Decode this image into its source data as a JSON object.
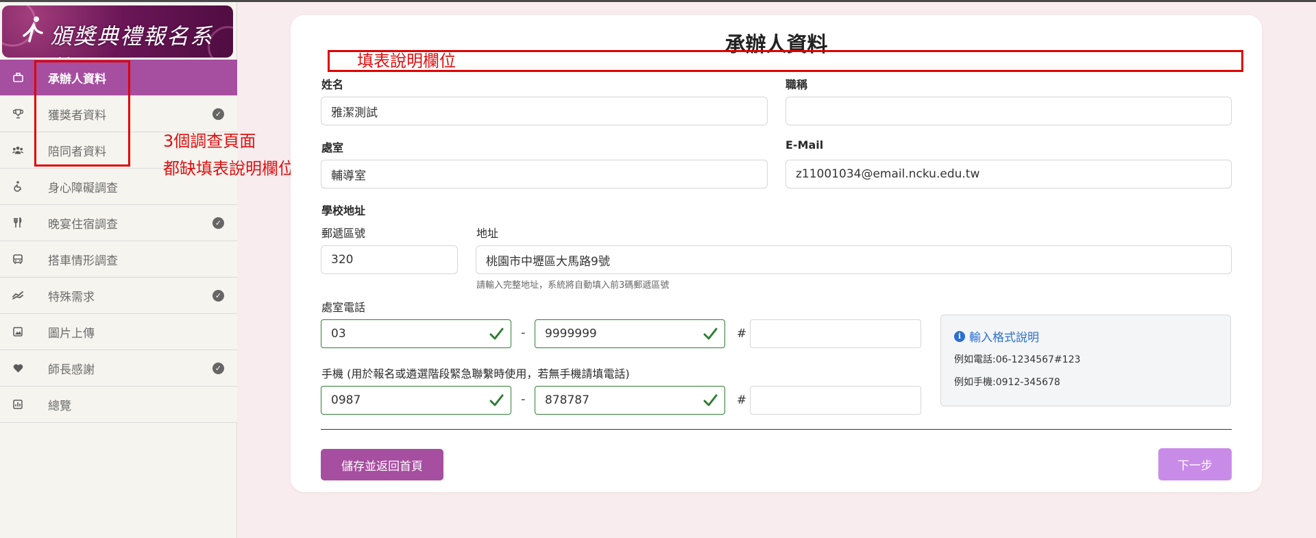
{
  "logo": {
    "text": "頒獎典禮報名系統",
    "glyph": "ﻝ"
  },
  "sidebar": {
    "items": [
      {
        "label": "承辦人資料",
        "icon": "briefcase-icon",
        "active": true,
        "checked": false
      },
      {
        "label": "獲獎者資料",
        "icon": "trophy-icon",
        "active": false,
        "checked": true
      },
      {
        "label": "陪同者資料",
        "icon": "users-icon",
        "active": false,
        "checked": false
      },
      {
        "label": "身心障礙調查",
        "icon": "accessibility-icon",
        "active": false,
        "checked": false
      },
      {
        "label": "晚宴住宿調查",
        "icon": "utensils-icon",
        "active": false,
        "checked": true
      },
      {
        "label": "搭車情形調查",
        "icon": "bus-icon",
        "active": false,
        "checked": false
      },
      {
        "label": "特殊需求",
        "icon": "hands-icon",
        "active": false,
        "checked": true
      },
      {
        "label": "圖片上傳",
        "icon": "image-icon",
        "active": false,
        "checked": false
      },
      {
        "label": "師長感謝",
        "icon": "heart-icon",
        "active": false,
        "checked": true
      },
      {
        "label": "總覽",
        "icon": "chart-icon",
        "active": false,
        "checked": false
      }
    ]
  },
  "annotations": {
    "field_note": "填表說明欄位",
    "page_note_line1": "3個調查頁面",
    "page_note_line2": "都缺填表說明欄位",
    "color": "#e00000"
  },
  "form": {
    "title": "承辦人資料",
    "name_label": "姓名",
    "name_value": "雅潔測試",
    "job_title_label": "職稱",
    "job_title_value": "",
    "office_label": "處室",
    "office_value": "輔導室",
    "email_label": "E-Mail",
    "email_value": "z11001034@email.ncku.edu.tw",
    "school_address_label": "學校地址",
    "zip_label": "郵遞區號",
    "zip_value": "320",
    "address_label": "地址",
    "address_value": "桃園市中壢區大馬路9號",
    "address_hint": "請輸入完整地址，系統將自動填入前3碼郵遞區號",
    "office_phone_label": "處室電話",
    "office_phone_area": "03",
    "office_phone_number": "9999999",
    "office_phone_ext": "",
    "mobile_label": "手機 (用於報名或遴選階段緊急聯繫時使用，若無手機請填電話)",
    "mobile_prefix": "0987",
    "mobile_number": "878787",
    "mobile_ext": "",
    "dash": "-",
    "hash": "#"
  },
  "format_help": {
    "title": "輸入格式說明",
    "icon": "info-icon",
    "line1": "例如電話:06-1234567#123",
    "line2": "例如手機:0912-345678"
  },
  "buttons": {
    "save_label": "儲存並返回首頁",
    "next_label": "下一步"
  },
  "colors": {
    "primary": "#a64ea0",
    "next_disabled": "#c88ce8",
    "valid": "#2e7d32",
    "info": "#2b6fd1",
    "page_bg": "#f9ecee"
  }
}
